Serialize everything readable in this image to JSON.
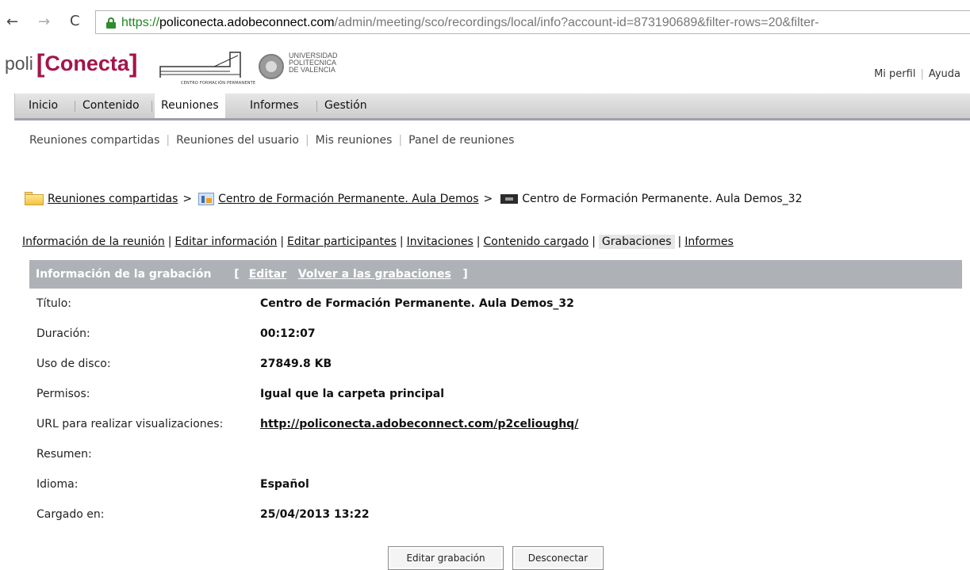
{
  "browser": {
    "url_scheme": "https://",
    "url_domain": "policonecta.adobeconnect.com",
    "url_path": "/admin/meeting/sco/recordings/local/info?account-id=873190689&filter-rows=20&filter-"
  },
  "header": {
    "logo_poli": "poli",
    "logo_bracket_open": "[",
    "logo_conecta": "Conecta",
    "logo_bracket_close": "]",
    "logo_sub": "CENTRO FORMACIÓN PERMANENTE",
    "upv_line1": "UNIVERSIDAD",
    "upv_line2": "POLITECNICA",
    "upv_line3": "DE VALENCIA",
    "links": [
      "Mi perfil",
      "Ayuda"
    ]
  },
  "mainnav": {
    "items": [
      "Inicio",
      "Contenido",
      "Reuniones",
      "Informes",
      "Gestión"
    ],
    "active": "Reuniones"
  },
  "subnav": {
    "items": [
      "Reuniones compartidas",
      "Reuniones del usuario",
      "Mis reuniones",
      "Panel de reuniones"
    ]
  },
  "breadcrumb": {
    "items": [
      "Reuniones compartidas",
      "Centro de Formación Permanente. Aula Demos",
      "Centro de Formación Permanente. Aula Demos_32"
    ],
    "separator": ">"
  },
  "subtabs": {
    "items": [
      "Información de la reunión",
      "Editar información",
      "Editar participantes",
      "Invitaciones",
      "Contenido cargado",
      "Grabaciones",
      "Informes"
    ],
    "active": "Grabaciones"
  },
  "panel": {
    "title": "Información de la grabación",
    "bracket_open": "[",
    "bracket_close": "]",
    "edit_link": "Editar",
    "back_link": "Volver a las grabaciones",
    "rows": [
      {
        "label": "Título:",
        "value": "Centro de Formación Permanente. Aula Demos_32"
      },
      {
        "label": "Duración:",
        "value": "00:12:07"
      },
      {
        "label": "Uso de disco:",
        "value": "27849.8 KB"
      },
      {
        "label": "Permisos:",
        "value": "Igual que la carpeta principal"
      },
      {
        "label": "URL para realizar visualizaciones:",
        "value": "http://policonecta.adobeconnect.com/p2celioughq/"
      },
      {
        "label": "Resumen:",
        "value": ""
      },
      {
        "label": "Idioma:",
        "value": "Español"
      },
      {
        "label": "Cargado en:",
        "value": "25/04/2013 13:22"
      }
    ]
  },
  "buttons": {
    "edit_recording": "Editar grabación",
    "disconnect": "Desconectar"
  },
  "colors": {
    "brand": "#a3154a",
    "panel_header": "#aeb2b7",
    "secure_green": "#1d8a1d"
  }
}
